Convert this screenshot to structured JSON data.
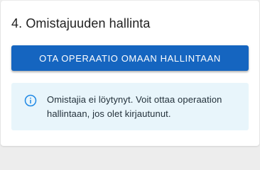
{
  "section": {
    "title": "4. Omistajuuden hallinta"
  },
  "actions": {
    "take_ownership_label": "OTA OPERAATIO OMAAN HALLINTAAN"
  },
  "notice": {
    "icon": "info-icon",
    "message": "Omistajia ei löytynyt. Voit ottaa operaation hallintaan, jos olet kirjautunut."
  },
  "colors": {
    "primary": "#1565c0",
    "info_background": "#e8f5fb",
    "info_icon": "#1e88e5"
  }
}
